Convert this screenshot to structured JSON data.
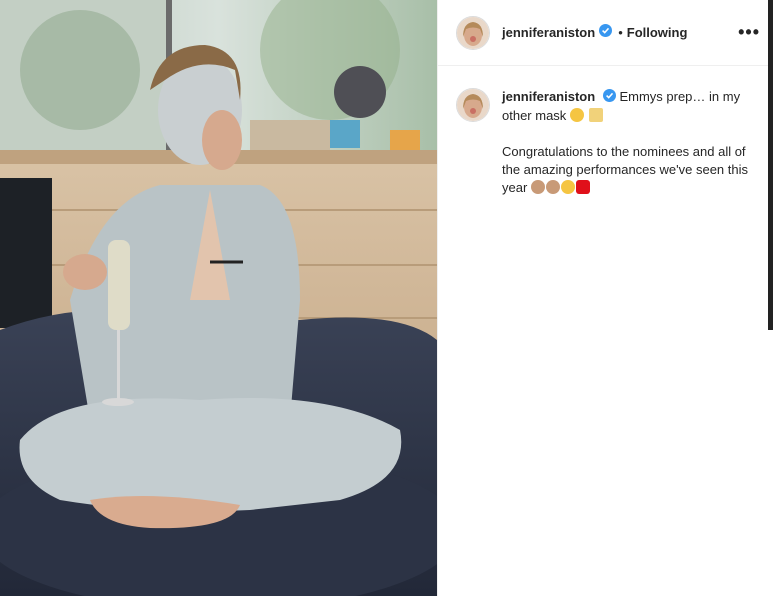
{
  "post": {
    "username": "jenniferaniston",
    "follow_label": "Following",
    "dot": "•",
    "more_label": "•••",
    "caption_line1": "Emmys prep… in my other mask",
    "caption_line2": "Congratulations to the nominees and all of the amazing performances we've seen this year",
    "emojis1": [
      "smiling-face-with-mask-icon",
      "clinking-glasses-icon"
    ],
    "emojis2": [
      "clapping-hands-icon",
      "clapping-hands-icon",
      "star-struck-icon",
      "red-heart-icon"
    ],
    "colors": {
      "verified": "#3897f0",
      "heart": "#e0101a",
      "text": "#262626"
    }
  }
}
